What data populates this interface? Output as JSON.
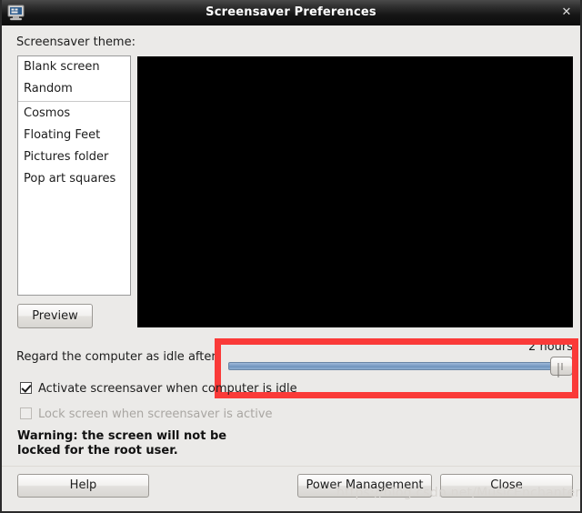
{
  "window": {
    "title": "Screensaver Preferences",
    "icon": "monitor-icon",
    "close_label": "✕",
    "background": "#ebeae8",
    "titlebar_color": "#161616"
  },
  "theme": {
    "label": "Screensaver theme:",
    "items": [
      {
        "label": "Blank screen",
        "group": 1
      },
      {
        "label": "Random",
        "group": 1
      },
      {
        "label": "Cosmos",
        "group": 2
      },
      {
        "label": "Floating Feet",
        "group": 2
      },
      {
        "label": "Pictures folder",
        "group": 2
      },
      {
        "label": "Pop art squares",
        "group": 2
      }
    ],
    "preview_button": "Preview",
    "preview_area_color": "#000000"
  },
  "idle": {
    "label": "Regard the computer as idle after:",
    "value_text": "2 hours",
    "slider_percent": 96
  },
  "options": [
    {
      "label": "Activate screensaver when computer is idle",
      "checked": true,
      "disabled": false
    },
    {
      "label": "Lock screen when screensaver is active",
      "checked": false,
      "disabled": true
    }
  ],
  "warning": {
    "line1": "Warning: the screen will not be",
    "line2": "locked for the root user."
  },
  "actions": {
    "help": "Help",
    "power_management": "Power Management",
    "close": "Close"
  },
  "annotation": {
    "highlight_color": "#fa3a38",
    "target": "idle-timeout-slider"
  },
  "watermark": "https://blog.csdn.net/MusicEnchanter"
}
